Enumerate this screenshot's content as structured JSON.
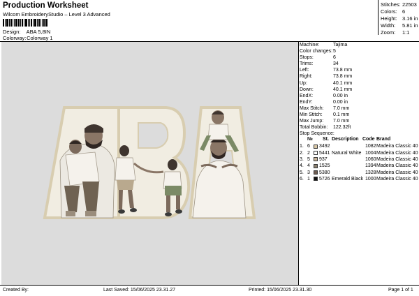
{
  "header": {
    "title": "Production Worksheet",
    "subtitle": "Wilcom EmbroideryStudio – Level 3 Advanced",
    "design_label": "Design:",
    "design_value": "ABA 5,8IN",
    "colorway_label": "Colorway:",
    "colorway_value": "Colorway 1"
  },
  "stats": {
    "stitches_label": "Stitches:",
    "stitches": "22503",
    "colors_label": "Colors:",
    "colors": "6",
    "height_label": "Height:",
    "height": "3.16 in",
    "width_label": "Width:",
    "width": "5.81 in",
    "zoom_label": "Zoom:",
    "zoom": "1:1"
  },
  "machine": {
    "rows": [
      {
        "label": "Machine:",
        "value": "Tajima"
      },
      {
        "label": "Color changes:",
        "value": "5"
      },
      {
        "label": "Stops:",
        "value": "6"
      },
      {
        "label": "Trims:",
        "value": "34"
      },
      {
        "label": "Left:",
        "value": "73.8 mm"
      },
      {
        "label": "Right:",
        "value": "73.8 mm"
      },
      {
        "label": "Up:",
        "value": "40.1 mm"
      },
      {
        "label": "Down:",
        "value": "40.1 mm"
      },
      {
        "label": "EndX:",
        "value": "0.00 in"
      },
      {
        "label": "EndY:",
        "value": "0.00 in"
      },
      {
        "label": "Max Stitch:",
        "value": "7.0 mm"
      },
      {
        "label": "Min Stitch:",
        "value": "0.1 mm"
      },
      {
        "label": "Max Jump:",
        "value": "7.0 mm"
      },
      {
        "label": "Total Bobbin:",
        "value": "122.32ft"
      }
    ]
  },
  "stop_sequence": {
    "title": "Stop Sequence:",
    "headers": {
      "n": "№",
      "st": "St.",
      "desc": "Description",
      "code": "Code",
      "brand": "Brand"
    },
    "rows": [
      {
        "stop": "1.",
        "n": "6",
        "color": "#d8c7a6",
        "st": "3492",
        "desc": "",
        "code": "1082",
        "brand": "Madeira Classic 40"
      },
      {
        "stop": "2.",
        "n": "2",
        "color": "#ffffff",
        "st": "5441",
        "desc": "Natural White",
        "code": "1004",
        "brand": "Madeira Classic 40"
      },
      {
        "stop": "3.",
        "n": "5",
        "color": "#c8b49a",
        "st": "937",
        "desc": "",
        "code": "1060",
        "brand": "Madeira Classic 40"
      },
      {
        "stop": "4.",
        "n": "4",
        "color": "#8a8070",
        "st": "1525",
        "desc": "",
        "code": "1394",
        "brand": "Madeira Classic 40"
      },
      {
        "stop": "5.",
        "n": "3",
        "color": "#6e5c52",
        "st": "5380",
        "desc": "",
        "code": "1328",
        "brand": "Madeira Classic 40"
      },
      {
        "stop": "6.",
        "n": "1",
        "color": "#111111",
        "st": "5726",
        "desc": "Emerald Black",
        "code": "1000",
        "brand": "Madeira Classic 40"
      }
    ]
  },
  "footer": {
    "created_by": "Created By:",
    "last_saved": "Last Saved: 15/06/2025 23.31.27",
    "printed": "Printed: 15/06/2025 23.31.30",
    "page": "Page 1 of 1"
  },
  "colors": {
    "canvas_bg": "#dcdcdc",
    "letter_outline": "#d8cdb0",
    "letter_fill": "#f1ede2"
  }
}
